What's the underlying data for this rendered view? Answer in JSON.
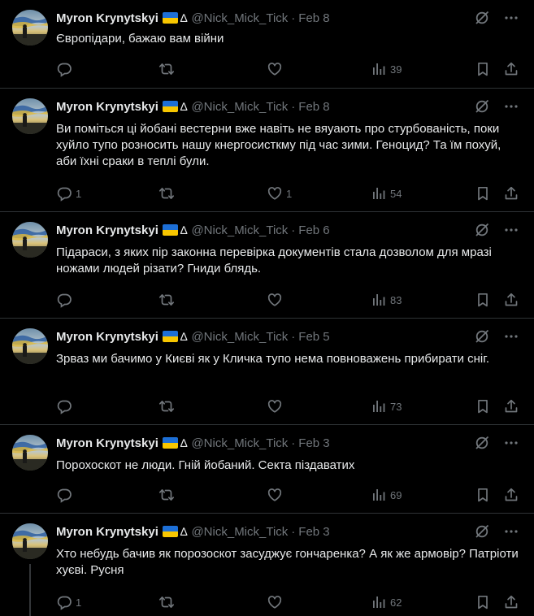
{
  "tweets": [
    {
      "name": "Myron Krynytskyi",
      "handle": "@Nick_Mick_Tick",
      "separator": "·",
      "date": "Feb 8",
      "text": "Європідари, бажаю вам війни",
      "replies": "",
      "retweets": "",
      "likes": "",
      "views": "39"
    },
    {
      "name": "Myron Krynytskyi",
      "handle": "@Nick_Mick_Tick",
      "separator": "·",
      "date": "Feb 8",
      "text": "Ви поміться ці йобані  вестерни вже навіть не вяуають про стурбованість, поки хуйло тупо розносить нашу кнергосисткму під час зими. Геноцид? Та їм похуй, аби їхні сраки в теплі були.",
      "replies": "1",
      "retweets": "",
      "likes": "1",
      "views": "54"
    },
    {
      "name": "Myron Krynytskyi",
      "handle": "@Nick_Mick_Tick",
      "separator": "·",
      "date": "Feb 6",
      "text": "Підараси, з яких пір законна перевірка документів стала дозволом для мразі ножами людей різати? Гниди блядь.",
      "replies": "",
      "retweets": "",
      "likes": "",
      "views": "83"
    },
    {
      "name": "Myron Krynytskyi",
      "handle": "@Nick_Mick_Tick",
      "separator": "·",
      "date": "Feb 5",
      "text": "Зрваз ми бачимо у Києві як у Кличка тупо нема повноважень прибирати сніг.",
      "replies": "",
      "retweets": "",
      "likes": "",
      "views": "73"
    },
    {
      "name": "Myron Krynytskyi",
      "handle": "@Nick_Mick_Tick",
      "separator": "·",
      "date": "Feb 3",
      "text": "Порохоскот не люди. Гній йобаний. Секта піздаватих",
      "replies": "",
      "retweets": "",
      "likes": "",
      "views": "69"
    },
    {
      "name": "Myron Krynytskyi",
      "handle": "@Nick_Mick_Tick",
      "separator": "·",
      "date": "Feb 3",
      "text": "Хто небудь бачив як порозоскот засуджує гончаренка? А як же армовір? Патріоти хуєві. Русня",
      "replies": "1",
      "retweets": "",
      "likes": "",
      "views": "62"
    }
  ],
  "badge_symbol": "∆",
  "icons": {
    "grok": "grok-icon",
    "more": "more-icon",
    "reply": "reply-icon",
    "retweet": "retweet-icon",
    "like": "like-icon",
    "views": "views-icon",
    "bookmark": "bookmark-icon",
    "share": "share-icon"
  },
  "colors": {
    "background": "#000000",
    "text": "#e7e9ea",
    "muted": "#71767b",
    "divider": "#2f3336",
    "flag_blue": "#1d6fd6",
    "flag_yellow": "#f7c600"
  }
}
